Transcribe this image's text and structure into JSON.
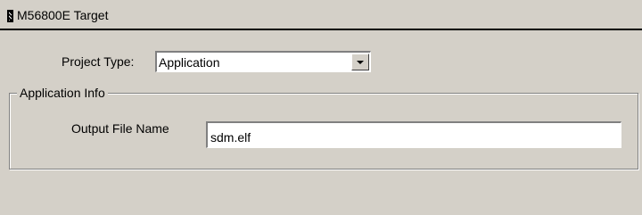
{
  "panel": {
    "title": "M56800E Target"
  },
  "project_type": {
    "label": "Project Type:",
    "value": "Application"
  },
  "application_info": {
    "group_label": "Application Info",
    "output_file_label": "Output File Name",
    "output_file_value": "sdm.elf"
  }
}
